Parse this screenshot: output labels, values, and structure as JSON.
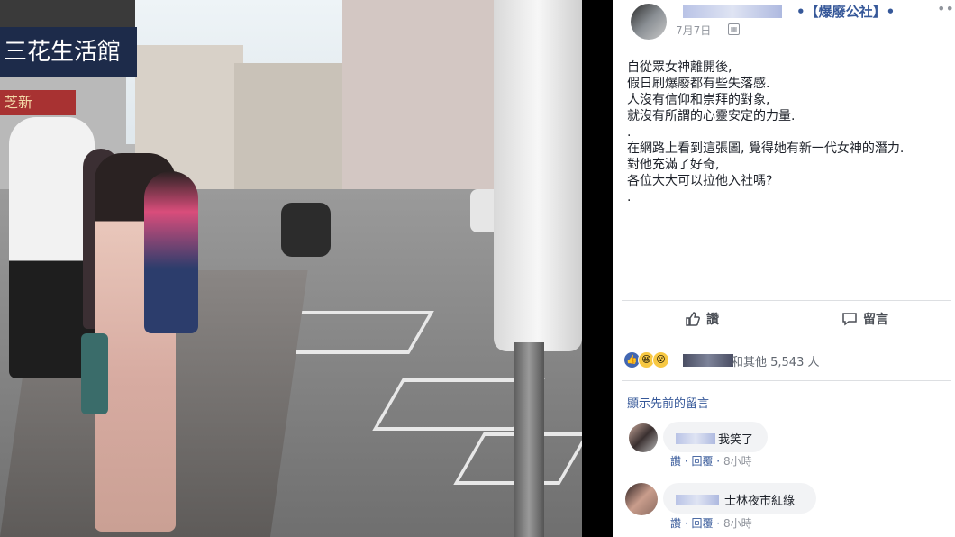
{
  "photo": {
    "shop_sign": "三花生活館",
    "red_sign": "芝新"
  },
  "post": {
    "group_name": "•【爆廢公社】•",
    "date": "7月7日",
    "menu_icon": "more-dots-icon",
    "body": "自從眾女神離開後,\n假日刷爆廢都有些失落感.\n人沒有信仰和崇拜的對象,\n就沒有所謂的心靈安定的力量.\n.\n在網路上看到這張圖, 覺得她有新一代女神的潛力.\n對他充滿了好奇,\n各位大大可以拉他入社嗎?\n."
  },
  "actions": {
    "like_label": "讚",
    "comment_label": "留言"
  },
  "reactions": {
    "icons": [
      "like-icon",
      "haha-icon",
      "wow-icon"
    ],
    "text": "和其他 5,543 人"
  },
  "comments": {
    "prev_link": "顯示先前的留言",
    "items": [
      {
        "text": "我笑了",
        "like": "讚",
        "reply": "回覆",
        "time": "8小時"
      },
      {
        "text": "士林夜市紅綠",
        "like": "讚",
        "reply": "回覆",
        "time": "8小時"
      }
    ]
  },
  "colors": {
    "link": "#365899",
    "text": "#1d2129",
    "meta": "#90949c"
  }
}
